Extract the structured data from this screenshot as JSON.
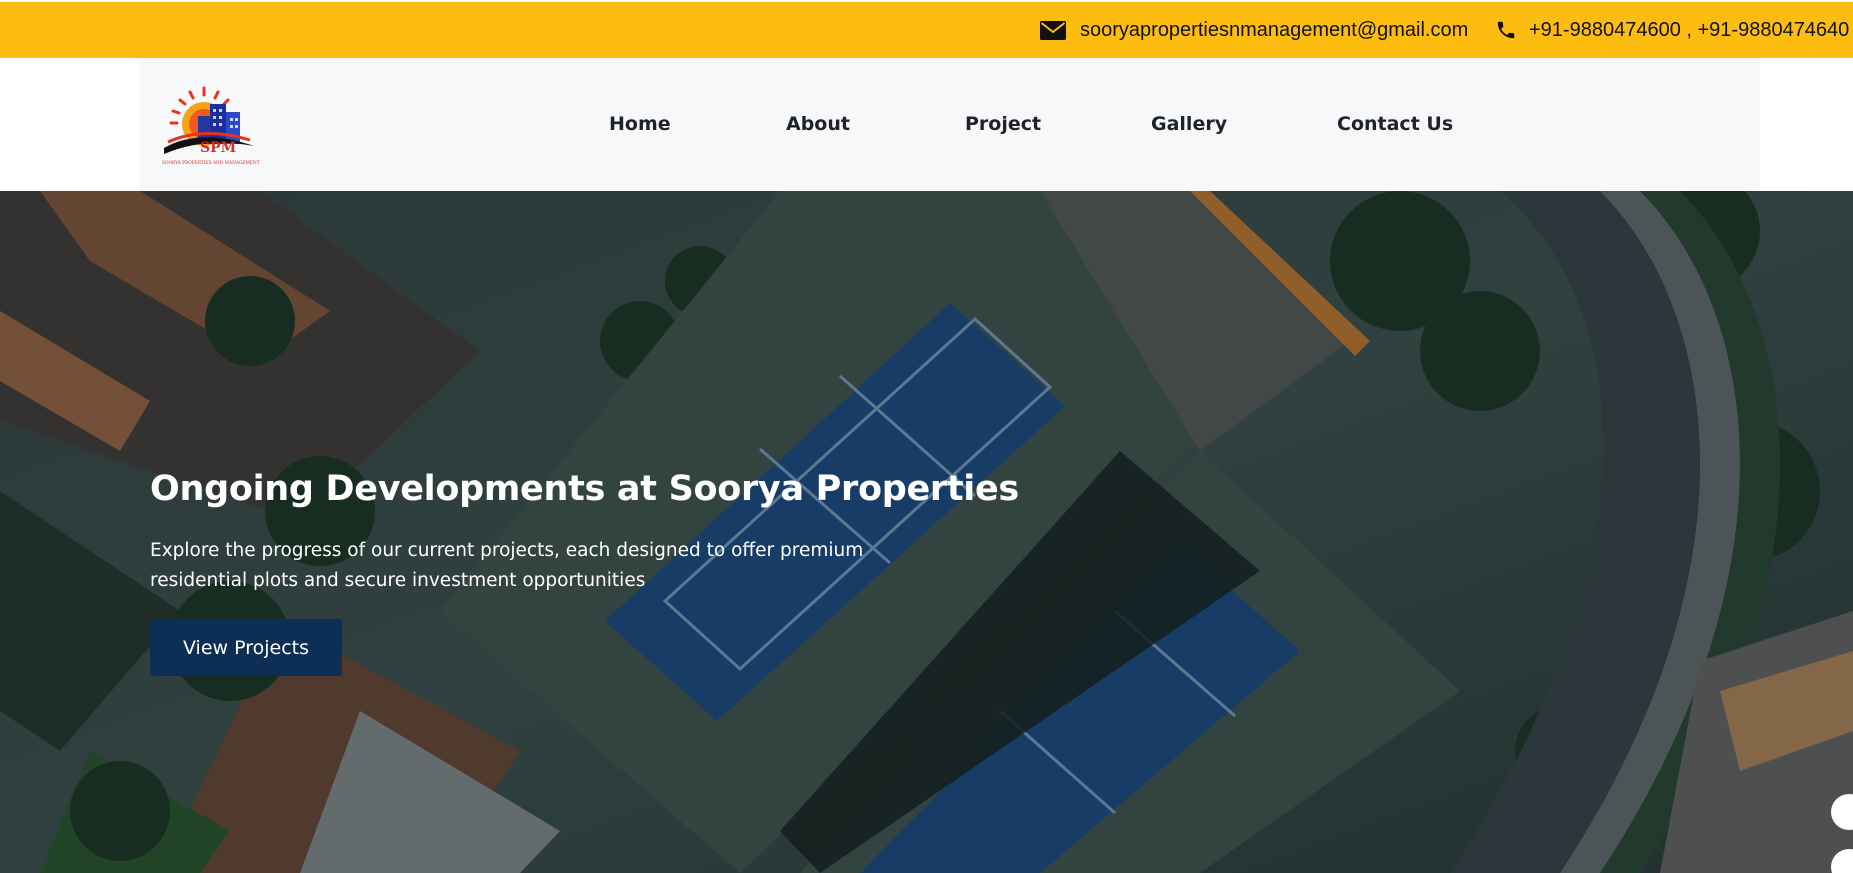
{
  "topbar": {
    "email": "sooryapropertiesnmanagement@gmail.com",
    "phone": "+91-9880474600 , +91-9880474640",
    "email_icon": "envelope-icon",
    "phone_icon": "phone-icon",
    "background_color": "#fdbd10"
  },
  "header": {
    "logo_icon": "soorya-logo-icon",
    "logo_text": "SOORYA PROPERTIES AND MANAGEMENT",
    "nav": {
      "home": "Home",
      "about": "About",
      "project": "Project",
      "gallery": "Gallery",
      "contact": "Contact Us"
    }
  },
  "hero": {
    "title": "Ongoing Developments at Soorya Properties",
    "subtitle": "Explore the progress of our current projects, each designed to offer premium residential plots and secure investment opportunities",
    "button_label": "View Projects",
    "button_color": "#0d2f56",
    "background_image": "aerial-view-residential-complex-with-tennis-courts"
  }
}
